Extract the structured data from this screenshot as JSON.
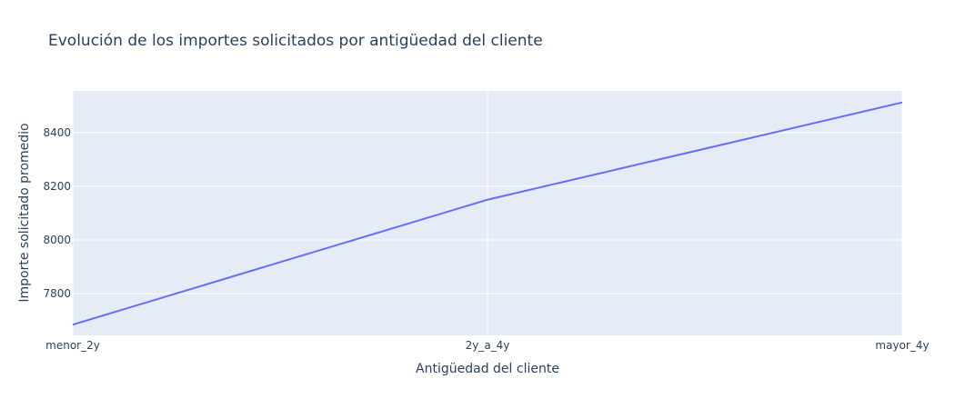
{
  "chart_data": {
    "type": "line",
    "title": "Evolución de los importes solicitados por antigüedad del cliente",
    "xlabel": "Antigüedad del cliente",
    "ylabel": "Importe solicitado promedio",
    "categories": [
      "menor_2y",
      "2y_a_4y",
      "mayor_4y"
    ],
    "series": [
      {
        "values": [
          7685,
          8150,
          8512
        ],
        "color": "#636efa"
      }
    ],
    "ylim": [
      7645,
      8555
    ],
    "yticks": [
      7800,
      8000,
      8200,
      8400
    ],
    "grid": true,
    "plot_bg": "#e5ecf6",
    "grid_color": "#ffffff"
  }
}
